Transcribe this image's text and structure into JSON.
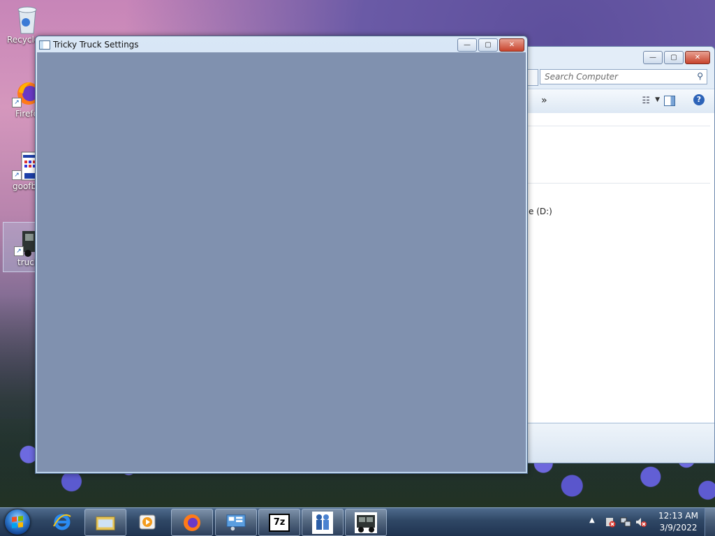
{
  "desktop": {
    "icons": [
      {
        "label": "Recycle Bin",
        "icon": "recycle-bin-icon"
      },
      {
        "label": "Firefox",
        "icon": "firefox-icon"
      },
      {
        "label": "goofball",
        "icon": "app-shortcut-icon"
      },
      {
        "label": "truck",
        "icon": "truck-icon"
      }
    ]
  },
  "explorer": {
    "search_placeholder": "Search Computer",
    "more_label": "»",
    "drive_label": "e (D:)"
  },
  "window": {
    "title": "Tricky Truck Settings",
    "minimize": "—",
    "maximize": "▢",
    "close": "✕"
  },
  "taskbar": {
    "items": [
      {
        "name": "internet-explorer-icon"
      },
      {
        "name": "file-explorer-icon"
      },
      {
        "name": "media-player-icon"
      },
      {
        "name": "firefox-icon"
      },
      {
        "name": "control-panel-icon"
      },
      {
        "name": "7zip-icon",
        "label": "7z"
      },
      {
        "name": "people-app-icon"
      },
      {
        "name": "truck-icon"
      }
    ],
    "time": "12:13 AM",
    "date": "3/9/2022"
  },
  "colors": {
    "client_area": "#8091af",
    "taskbar": "#2f4765"
  }
}
